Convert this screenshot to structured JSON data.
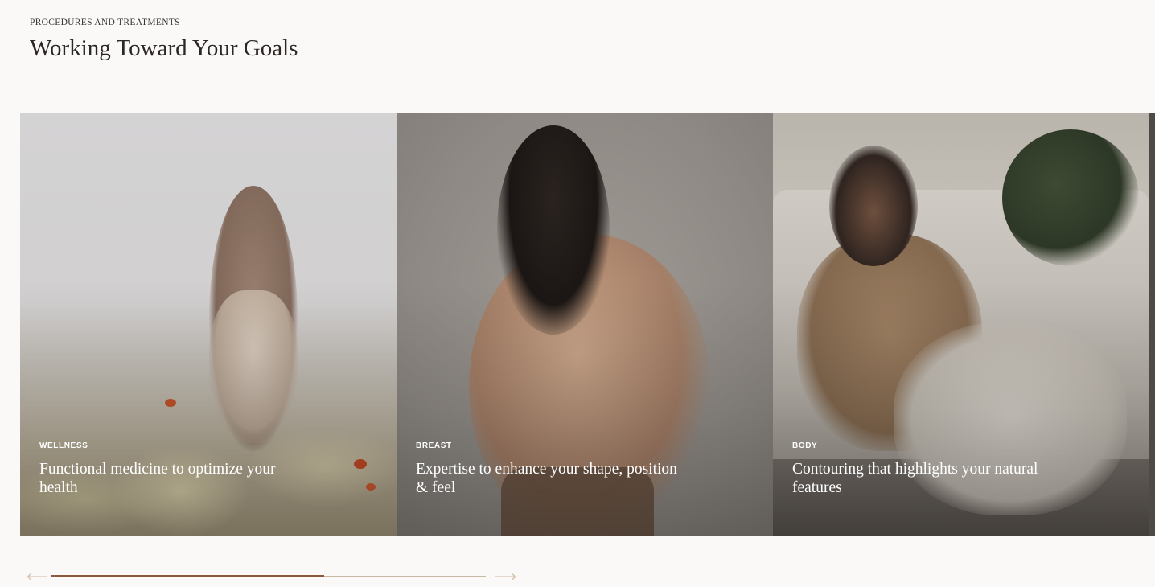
{
  "section": {
    "eyebrow": "PROCEDURES AND TREATMENTS",
    "title": "Working Toward Your Goals"
  },
  "cards": [
    {
      "category": "WELLNESS",
      "description": "Functional medicine to optimize your health",
      "image": "woman-in-flower-field"
    },
    {
      "category": "BREAST",
      "description": "Expertise to enhance your shape, position & feel",
      "image": "woman-posing-portrait"
    },
    {
      "category": "BODY",
      "description": "Contouring that highlights your natural features",
      "image": "woman-seated-on-floor"
    }
  ],
  "carousel": {
    "prev_icon": "arrow-left-icon",
    "next_icon": "arrow-right-icon",
    "prev_glyph": "⟵",
    "next_glyph": "⟶",
    "progress": 0.628
  },
  "colors": {
    "background": "#faf9f7",
    "accent": "#8b5a3c",
    "rule": "#b7a58e"
  }
}
